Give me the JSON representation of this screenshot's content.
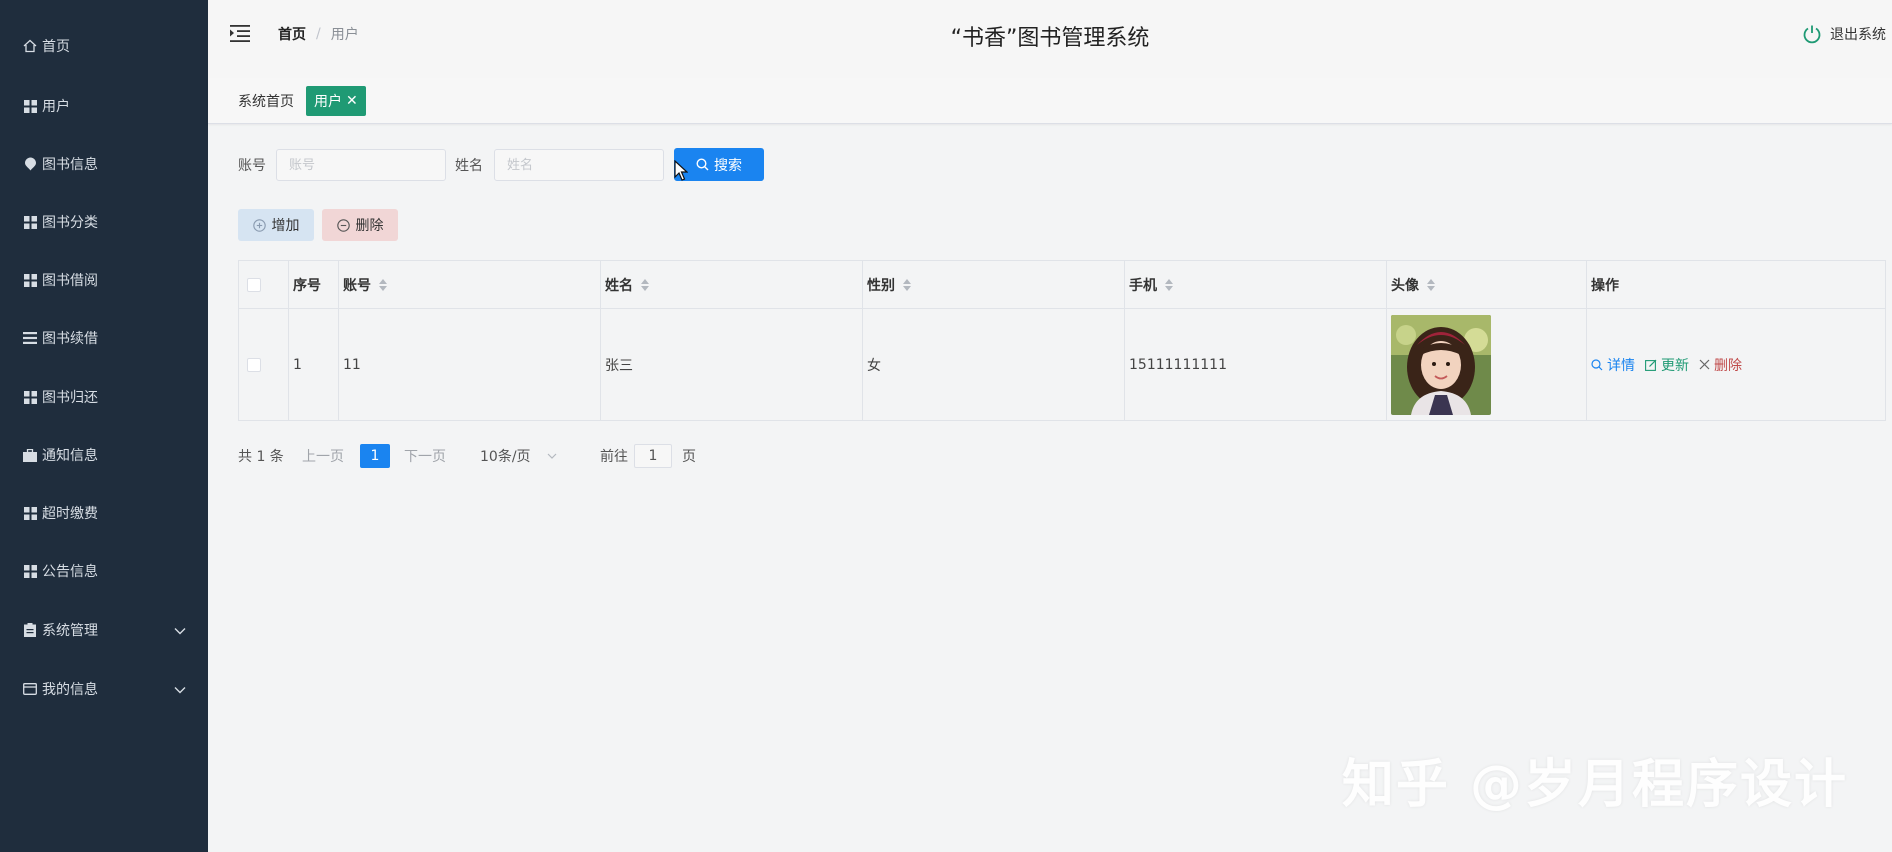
{
  "sidebar": {
    "items": [
      {
        "label": "首页",
        "icon": "home-icon"
      },
      {
        "label": "用户",
        "icon": "grid-icon"
      },
      {
        "label": "图书信息",
        "icon": "pin-icon"
      },
      {
        "label": "图书分类",
        "icon": "grid-icon"
      },
      {
        "label": "图书借阅",
        "icon": "grid-icon"
      },
      {
        "label": "图书续借",
        "icon": "list-icon"
      },
      {
        "label": "图书归还",
        "icon": "grid-icon"
      },
      {
        "label": "通知信息",
        "icon": "briefcase-icon"
      },
      {
        "label": "超时缴费",
        "icon": "grid-icon"
      },
      {
        "label": "公告信息",
        "icon": "grid-icon"
      },
      {
        "label": "系统管理",
        "icon": "clipboard-icon"
      },
      {
        "label": "我的信息",
        "icon": "wallet-icon"
      }
    ]
  },
  "header": {
    "breadcrumb_home": "首页",
    "breadcrumb_sep": "/",
    "breadcrumb_current": "用户",
    "title": "“书香”图书管理系统",
    "logout": "退出系统"
  },
  "tags": {
    "home": "系统首页",
    "active": "用户",
    "close": "✕"
  },
  "search": {
    "account_label": "账号",
    "account_placeholder": "账号",
    "name_label": "姓名",
    "name_placeholder": "姓名",
    "button": "搜索"
  },
  "actions": {
    "add": "增加",
    "delete": "删除"
  },
  "table": {
    "columns": [
      "序号",
      "账号",
      "姓名",
      "性别",
      "手机",
      "头像",
      "操作"
    ],
    "rows": [
      {
        "index": "1",
        "account": "11",
        "name": "张三",
        "gender": "女",
        "phone": "15111111111"
      }
    ],
    "ops": {
      "detail": "详情",
      "update": "更新",
      "delete": "删除"
    }
  },
  "pagination": {
    "total": "共 1 条",
    "prev": "上一页",
    "current": "1",
    "next": "下一页",
    "page_size": "10条/页",
    "goto": "前往",
    "goto_value": "1",
    "page_suffix": "页"
  },
  "colors": {
    "sidebar": "#1f2d3d",
    "primary": "#1a84f0",
    "tag_active": "#1f9a74"
  },
  "watermark": "知乎 @岁月程序设计"
}
